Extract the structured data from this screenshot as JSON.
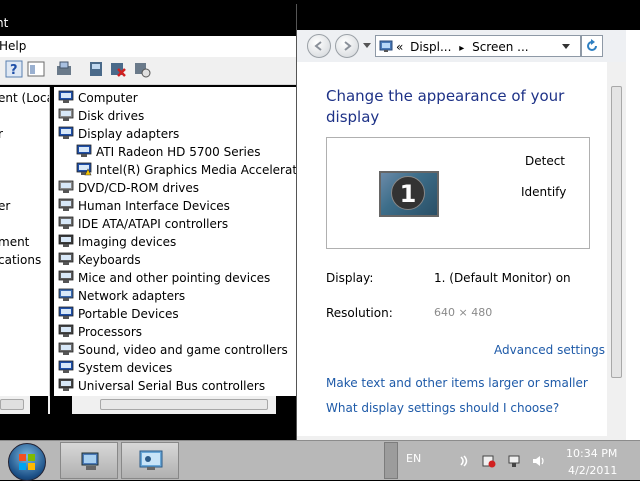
{
  "device_manager": {
    "title_fragment": "nt",
    "menu_fragment": "Help",
    "left_pane_items": [
      "ent (Local",
      "",
      "r",
      "",
      "",
      "er",
      "",
      "ment",
      "cations"
    ],
    "devices": [
      {
        "label": "Computer",
        "indent": 0,
        "icon": "computer-icon",
        "color": "#1f4fa8"
      },
      {
        "label": "Disk drives",
        "indent": 0,
        "icon": "disk-drive-icon",
        "color": "#8a8a8a"
      },
      {
        "label": "Display adapters",
        "indent": 0,
        "icon": "display-adapter-icon",
        "color": "#1f4fa8"
      },
      {
        "label": "ATI Radeon HD 5700 Series",
        "indent": 1,
        "icon": "monitor-icon",
        "color": "#1f4fa8"
      },
      {
        "label": "Intel(R) Graphics Media Accelerator H",
        "indent": 1,
        "icon": "monitor-warning-icon",
        "color": "#1f4fa8"
      },
      {
        "label": "DVD/CD-ROM drives",
        "indent": 0,
        "icon": "dvd-drive-icon",
        "color": "#8a8a8a"
      },
      {
        "label": "Human Interface Devices",
        "indent": 0,
        "icon": "hid-icon",
        "color": "#6a6a6a"
      },
      {
        "label": "IDE ATA/ATAPI controllers",
        "indent": 0,
        "icon": "ide-controller-icon",
        "color": "#6a6a6a"
      },
      {
        "label": "Imaging devices",
        "indent": 0,
        "icon": "camera-icon",
        "color": "#3a3a3a"
      },
      {
        "label": "Keyboards",
        "indent": 0,
        "icon": "keyboard-icon",
        "color": "#5a5a5a"
      },
      {
        "label": "Mice and other pointing devices",
        "indent": 0,
        "icon": "mouse-icon",
        "color": "#5a5a5a"
      },
      {
        "label": "Network adapters",
        "indent": 0,
        "icon": "network-icon",
        "color": "#3a6ab0"
      },
      {
        "label": "Portable Devices",
        "indent": 0,
        "icon": "portable-device-icon",
        "color": "#1f4fa8"
      },
      {
        "label": "Processors",
        "indent": 0,
        "icon": "processor-icon",
        "color": "#444444"
      },
      {
        "label": "Sound, video and game controllers",
        "indent": 0,
        "icon": "speaker-icon",
        "color": "#6a6a6a"
      },
      {
        "label": "System devices",
        "indent": 0,
        "icon": "system-device-icon",
        "color": "#1f4fa8"
      },
      {
        "label": "Universal Serial Bus controllers",
        "indent": 0,
        "icon": "usb-icon",
        "color": "#444444"
      }
    ]
  },
  "control_panel": {
    "breadcrumb_prefix": "«",
    "breadcrumb_1": "Displ...",
    "breadcrumb_sep": "▸",
    "breadcrumb_2": "Screen ...",
    "heading": "Change the appearance of your display",
    "detect_label": "Detect",
    "identify_label": "Identify",
    "monitor_number": "1",
    "display_label": "Display:",
    "display_value": "1. (Default Monitor) on",
    "resolution_label": "Resolution:",
    "resolution_value": "640 × 480",
    "advanced_link": "Advanced settings",
    "link_text_size": "Make text and other items larger or smaller",
    "link_help": "What display settings should I choose?"
  },
  "taskbar": {
    "language": "EN",
    "time": "10:34 PM",
    "date": "4/2/2011"
  },
  "colors": {
    "link": "#1e5aa8",
    "heading": "#1e3287",
    "taskbar": "#b8b8b8"
  }
}
